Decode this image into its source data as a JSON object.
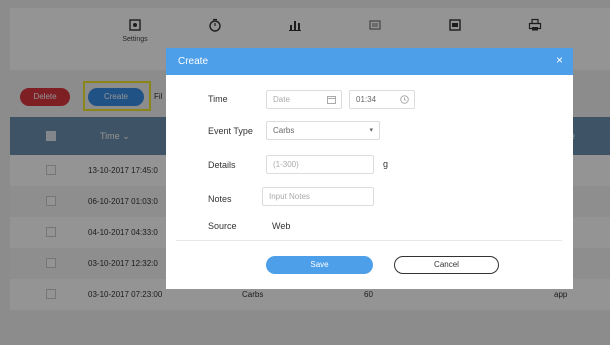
{
  "nav": {
    "items": [
      {
        "label": "Settings",
        "icon": "settings-icon"
      },
      {
        "label": "",
        "icon": "timer-icon"
      },
      {
        "label": "",
        "icon": "chart-icon"
      },
      {
        "label": "",
        "icon": "report-icon"
      },
      {
        "label": "",
        "icon": "calendar-icon"
      },
      {
        "label": "",
        "icon": "print-icon"
      }
    ]
  },
  "toolbar": {
    "delete_label": "Delete",
    "create_label": "Create",
    "filter_label": "Fil"
  },
  "table": {
    "header_time": "Time",
    "rows": [
      {
        "time": "13-10-2017 17:45:0",
        "type": "",
        "value": "",
        "source": ""
      },
      {
        "time": "06-10-2017 01:03:0",
        "type": "",
        "value": "",
        "source": ""
      },
      {
        "time": "04-10-2017 04:33:0",
        "type": "",
        "value": "",
        "source": ""
      },
      {
        "time": "03-10-2017 12:32:0",
        "type": "",
        "value": "",
        "source": ""
      },
      {
        "time": "03-10-2017 07:23:00",
        "type": "Carbs",
        "value": "60",
        "source": "app"
      }
    ]
  },
  "modal": {
    "title": "Create",
    "close_glyph": "×",
    "time_label": "Time",
    "date_placeholder": "Date",
    "time_value": "01:34",
    "event_type_label": "Event Type",
    "event_type_value": "Carbs",
    "details_label": "Details",
    "details_placeholder": "(1-300)",
    "details_unit": "g",
    "notes_label": "Notes",
    "notes_placeholder": "Input Notes",
    "source_label": "Source",
    "source_value": "Web",
    "save_label": "Save",
    "cancel_label": "Cancel"
  },
  "colors": {
    "accent": "#4d9fea",
    "danger": "#d9363e",
    "highlight": "#f2e62b"
  }
}
